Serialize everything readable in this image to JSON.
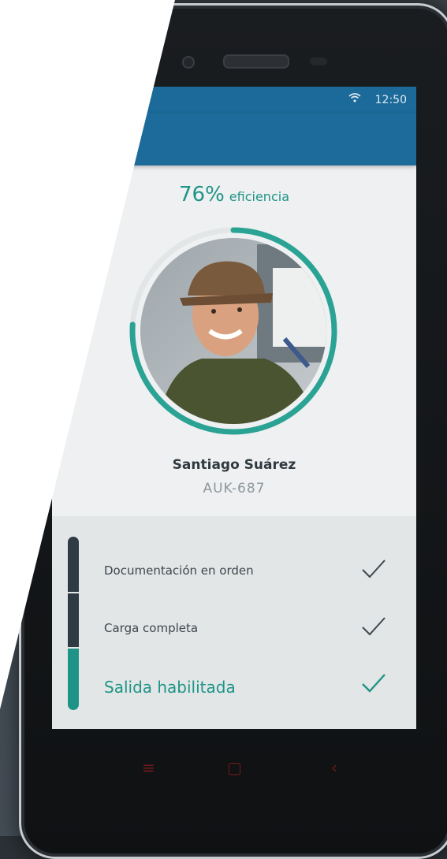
{
  "status_bar": {
    "time": "12:50",
    "wifi_icon": "wifi-icon"
  },
  "profile": {
    "efficiency_percent": "76%",
    "efficiency_label": "eficiencia",
    "efficiency_value": 0.76,
    "name": "Santiago Suárez",
    "plate": "AUK-687"
  },
  "checklist": {
    "items": [
      {
        "label": "Documentación en orden",
        "checked": true
      },
      {
        "label": "Carga completa",
        "checked": true
      },
      {
        "label": "Salida habilitada",
        "checked": true
      }
    ]
  },
  "colors": {
    "app_bar": "#1c6b9b",
    "accent": "#1f9486",
    "dark": "#2e3b44"
  }
}
